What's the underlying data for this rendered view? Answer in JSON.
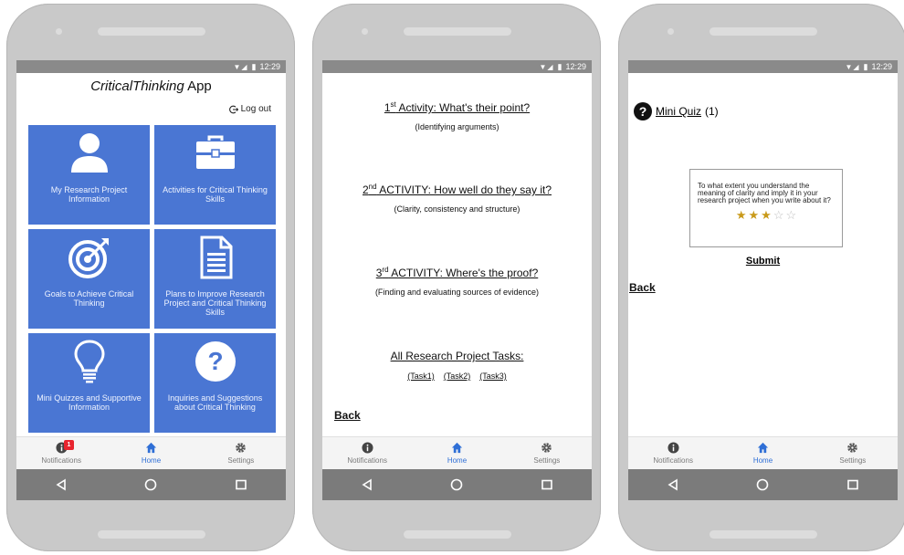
{
  "status": {
    "time": "12:29",
    "signal": "▼◢"
  },
  "nav": {
    "notifications": "Notifications",
    "home": "Home",
    "settings": "Settings",
    "badge": "1"
  },
  "screen1": {
    "title_italic": "CriticalThinking",
    "title_rest": " App",
    "logout": "Log out",
    "tiles": [
      {
        "label": "My Research Project Information",
        "icon": "person-icon"
      },
      {
        "label": "Activities for Critical Thinking Skills",
        "icon": "briefcase-icon"
      },
      {
        "label": "Goals to Achieve Critical Thinking",
        "icon": "target-icon"
      },
      {
        "label": "Plans to Improve Research Project and Critical Thinking Skills",
        "icon": "document-icon"
      },
      {
        "label": "Mini Quizzes and Supportive Information",
        "icon": "lightbulb-icon"
      },
      {
        "label": "Inquiries and Suggestions about Critical Thinking",
        "icon": "question-icon"
      }
    ]
  },
  "screen2": {
    "activities": [
      {
        "num": "1",
        "sup": "st",
        "title": " Activity: What's their point?",
        "sub": "(Identifying arguments)"
      },
      {
        "num": "2",
        "sup": "nd",
        "title": " ACTIVITY: How well do they say it?",
        "sub": "(Clarity, consistency and structure)"
      },
      {
        "num": "3",
        "sup": "rd",
        "title": " ACTIVITY: Where's the proof?",
        "sub": "(Finding and evaluating sources of evidence)"
      }
    ],
    "all_tasks": "All Research Project Tasks:",
    "tasks": [
      "(Task1)",
      "(Task2)",
      "(Task3)"
    ],
    "back": "Back"
  },
  "screen3": {
    "quiz_label": "Mini Quiz",
    "quiz_count": " (1)",
    "question": "To what extent you understand the meaning of clarity and imply it in your research project when you write about it?",
    "rating": 3,
    "rating_max": 5,
    "submit": "Submit",
    "back": "Back"
  },
  "colors": {
    "tile": "#4a76d3",
    "active_nav": "#2f6fd6",
    "badge": "#e8242e",
    "star": "#c99a1a"
  }
}
